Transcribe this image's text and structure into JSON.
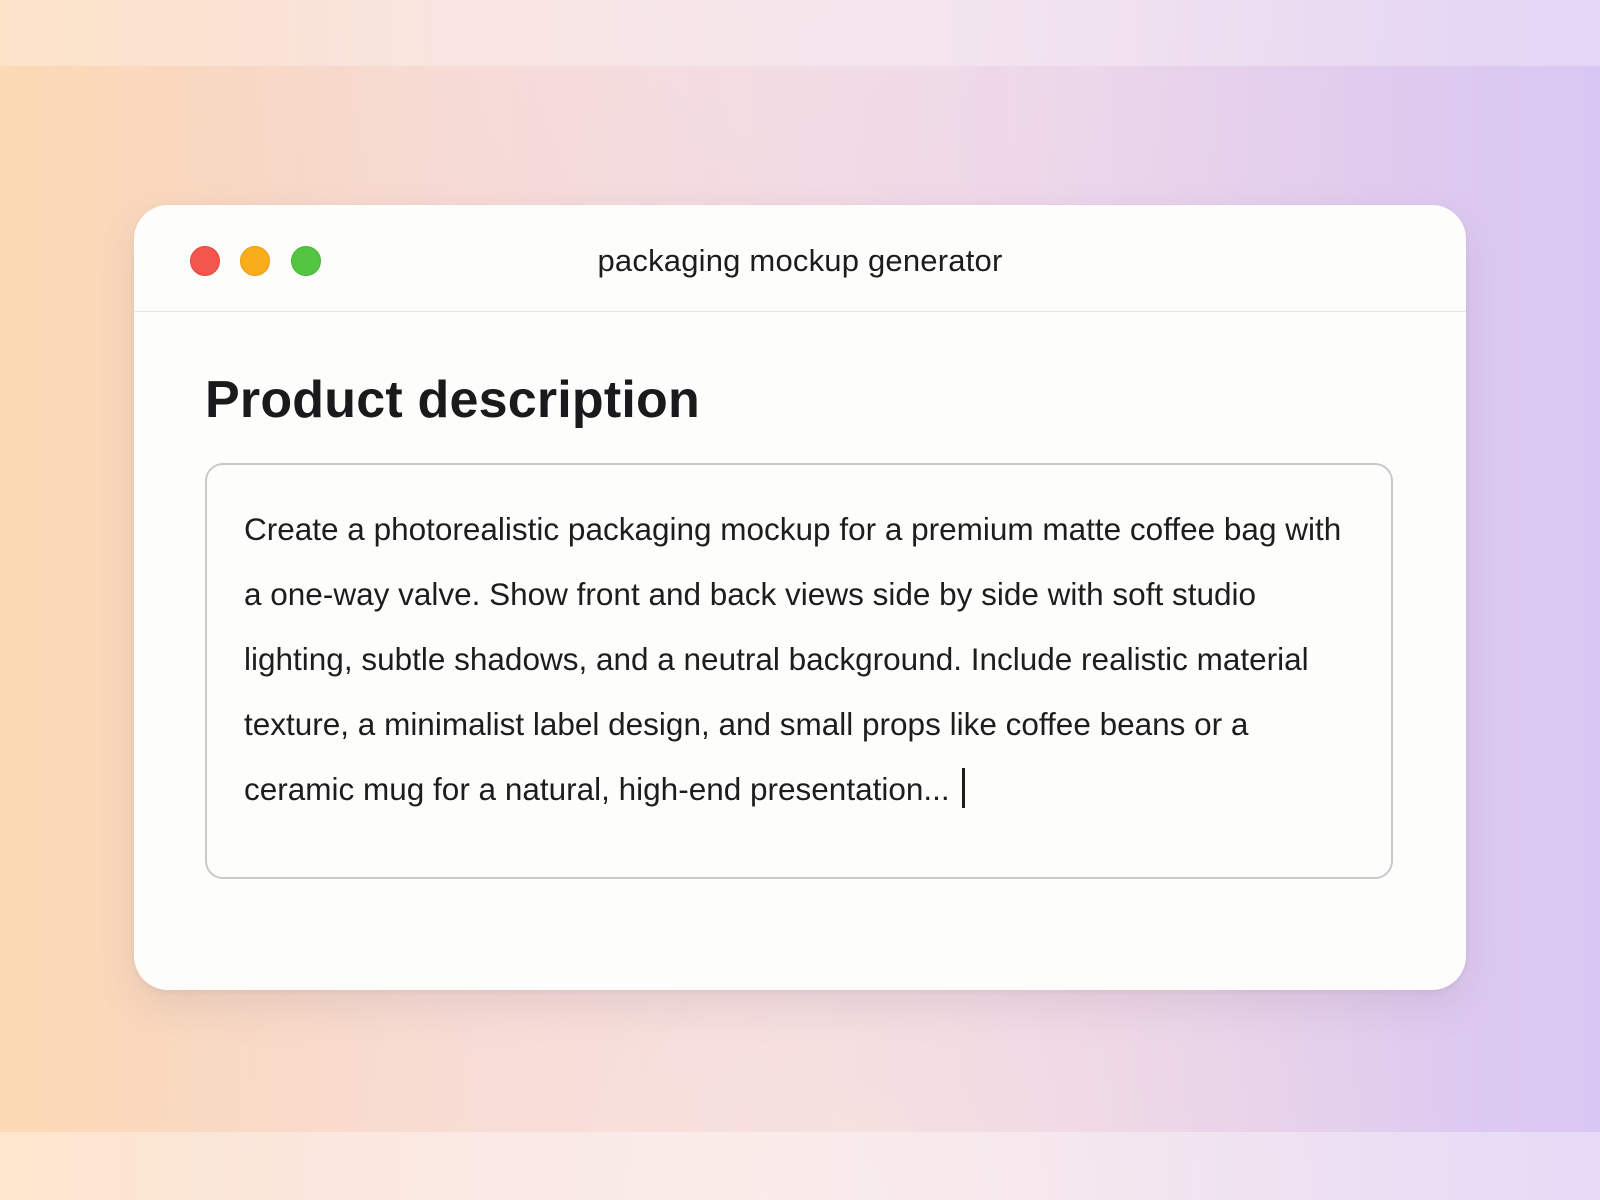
{
  "window": {
    "title": "packaging mockup generator",
    "controls": {
      "close_color": "#f2564d",
      "minimize_color": "#f9ad1b",
      "zoom_color": "#54c542"
    }
  },
  "form": {
    "heading": "Product description",
    "description": {
      "value": "Create a photorealistic packaging mockup for a premium matte coffee bag with a one-way valve. Show front and back views side by side with soft studio lighting, subtle shadows, and a neutral background. Include realistic material texture, a minimalist label design, and small props like coffee beans or a ceramic mug for a natural, high-end presentation..."
    }
  }
}
